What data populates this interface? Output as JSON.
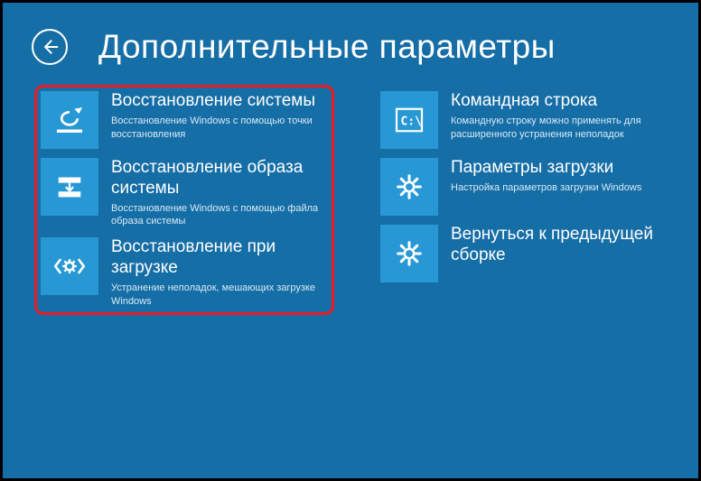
{
  "header": {
    "title": "Дополнительные параметры"
  },
  "left": [
    {
      "title": "Восстановление системы",
      "desc": "Восстановление Windows с помощью точки восстановления"
    },
    {
      "title": "Восстановление образа системы",
      "desc": "Восстановление Windows с помощью файла образа системы"
    },
    {
      "title": "Восстановление при загрузке",
      "desc": "Устранение неполадок, мешающих загрузке Windows"
    }
  ],
  "right": [
    {
      "title": "Командная строка",
      "desc": "Командную строку можно применять для расширенного устранения неполадок"
    },
    {
      "title": "Параметры загрузки",
      "desc": "Настройка параметров загрузки Windows"
    },
    {
      "title": "Вернуться к предыдущей сборке",
      "desc": ""
    }
  ]
}
